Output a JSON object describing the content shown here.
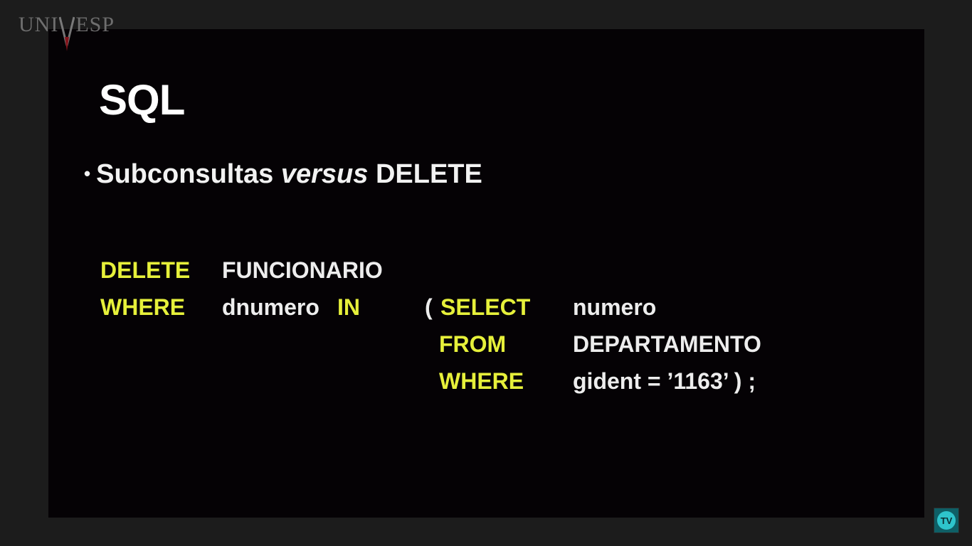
{
  "logo": {
    "left": "UNI",
    "right": "ESP",
    "mark": "univesp-v-logo"
  },
  "slide": {
    "title": "SQL",
    "bullet": {
      "symbol": "•",
      "text_before": "Subconsultas",
      "text_italic": "versus",
      "text_after": "DELETE"
    },
    "code": {
      "line1_kw": "DELETE",
      "line1_id": "FUNCIONARIO",
      "line2_kw": "WHERE",
      "line2_id": "dnumero",
      "line2_kw2": "IN",
      "sub_paren": "(",
      "sub_select_kw": "SELECT",
      "sub_select_id": "numero",
      "sub_from_kw": "FROM",
      "sub_from_id": "DEPARTAMENTO",
      "sub_where_kw": "WHERE",
      "sub_where_id": "gident = ’1163’ ) ;"
    }
  },
  "badge": {
    "label": "TV",
    "icon": "univesp-tv-icon"
  },
  "colors": {
    "background_outer": "#1c1c1c",
    "slide_background": "#050205",
    "keyword": "#e6f03a",
    "identifier": "#ededed",
    "title": "#ffffff",
    "badge": "#2ec4cc"
  }
}
